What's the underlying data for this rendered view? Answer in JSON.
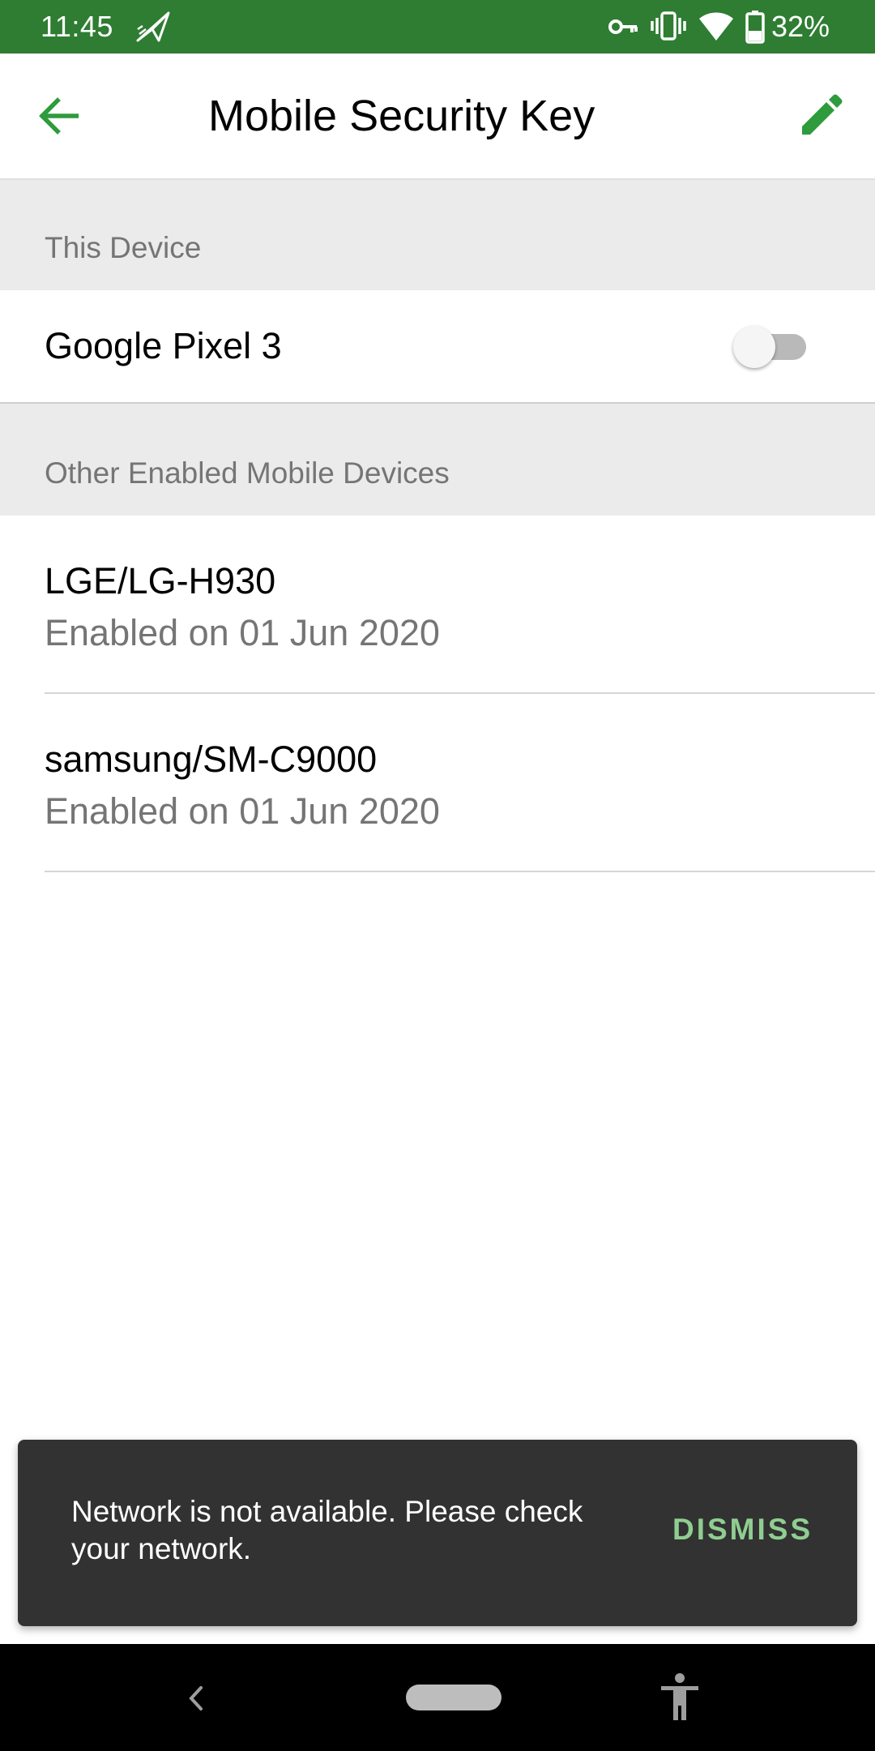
{
  "status_bar": {
    "time": "11:45",
    "battery_percent": "32%",
    "icons": [
      "paper-plane-icon",
      "key-icon",
      "vibrate-icon",
      "wifi-icon",
      "battery-icon"
    ],
    "background_color": "#2e7d32"
  },
  "app_bar": {
    "title": "Mobile Security Key",
    "back_icon": "arrow-back-icon",
    "edit_icon": "pencil-icon",
    "accent_color": "#2e9b3c"
  },
  "this_device": {
    "header": "This Device",
    "device_name": "Google Pixel 3",
    "toggle_enabled": false
  },
  "other_devices": {
    "header": "Other Enabled Mobile Devices",
    "items": [
      {
        "name": "LGE/LG-H930",
        "status": "Enabled on 01 Jun 2020"
      },
      {
        "name": "samsung/SM-C9000",
        "status": "Enabled on 01 Jun 2020"
      }
    ]
  },
  "snackbar": {
    "message": "Network is not available. Please check your network.",
    "action_label": "DISMISS",
    "action_color": "#8fce91"
  },
  "nav_bar": {
    "icons": [
      "nav-back-icon",
      "nav-home-pill",
      "accessibility-icon"
    ]
  }
}
